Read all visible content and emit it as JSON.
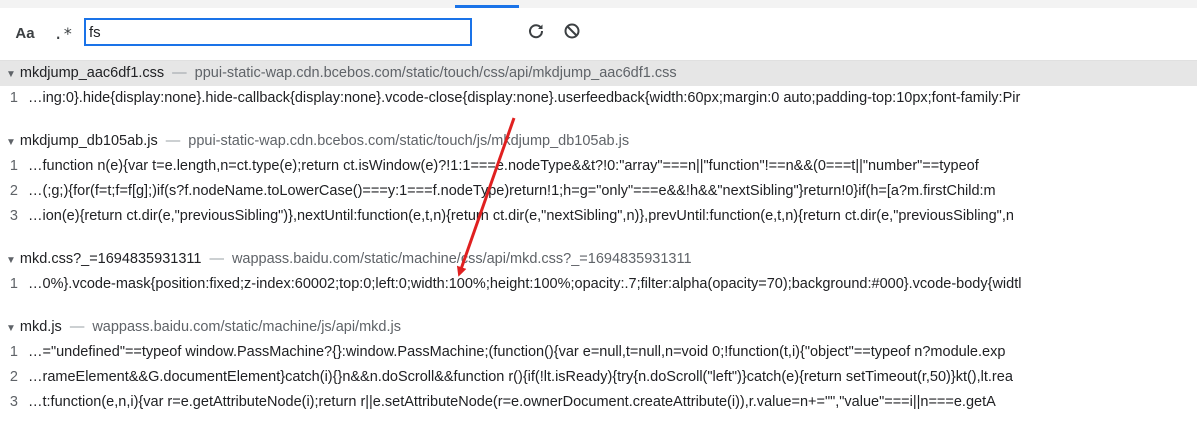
{
  "search": {
    "case_label": "Aa",
    "regex_label": ".*",
    "query": "fs"
  },
  "icons": {
    "refresh": "refresh-icon",
    "clear": "clear-icon",
    "expand": "triangle-down-icon"
  },
  "colors": {
    "accent": "#1a73e8",
    "selected_row": "#e6e6e6",
    "annotation_arrow": "#e02020"
  },
  "files": [
    {
      "name": "mkdjump_aac6df1.css",
      "separator": "—",
      "url": "ppui-static-wap.cdn.bcebos.com/static/touch/css/api/mkdjump_aac6df1.css",
      "lines": [
        {
          "num": "1",
          "text": "…ing:0}.hide{display:none}.hide-callback{display:none}.vcode-close{display:none}.userfeedback{width:60px;margin:0 auto;padding-top:10px;font-family:Pir"
        }
      ]
    },
    {
      "name": "mkdjump_db105ab.js",
      "separator": "—",
      "url": "ppui-static-wap.cdn.bcebos.com/static/touch/js/mkdjump_db105ab.js",
      "lines": [
        {
          "num": "1",
          "text": "…function n(e){var t=e.length,n=ct.type(e);return ct.isWindow(e)?!1:1===e.nodeType&&t?!0:\"array\"===n||\"function\"!==n&&(0===t||\"number\"==typeof"
        },
        {
          "num": "2",
          "text": "…(;g;){for(f=t;f=f[g];)if(s?f.nodeName.toLowerCase()===y:1===f.nodeType)return!1;h=g=\"only\"===e&&!h&&\"nextSibling\"}return!0}if(h=[a?m.firstChild:m"
        },
        {
          "num": "3",
          "text": "…ion(e){return ct.dir(e,\"previousSibling\")},nextUntil:function(e,t,n){return ct.dir(e,\"nextSibling\",n)},prevUntil:function(e,t,n){return ct.dir(e,\"previousSibling\",n"
        }
      ]
    },
    {
      "name": "mkd.css?_=1694835931311",
      "separator": "—",
      "url": "wappass.baidu.com/static/machine/css/api/mkd.css?_=1694835931311",
      "lines": [
        {
          "num": "1",
          "text": "…0%}.vcode-mask{position:fixed;z-index:60002;top:0;left:0;width:100%;height:100%;opacity:.7;filter:alpha(opacity=70);background:#000}.vcode-body{widtl"
        }
      ]
    },
    {
      "name": "mkd.js",
      "separator": "—",
      "url": "wappass.baidu.com/static/machine/js/api/mkd.js",
      "lines": [
        {
          "num": "1",
          "text": "…=\"undefined\"==typeof window.PassMachine?{}:window.PassMachine;(function(){var e=null,t=null,n=void 0;!function(t,i){\"object\"==typeof n?module.exp"
        },
        {
          "num": "2",
          "text": "…rameElement&&G.documentElement}catch(i){}n&&n.doScroll&&function r(){if(!lt.isReady){try{n.doScroll(\"left\")}catch(e){return setTimeout(r,50)}kt(),lt.rea"
        },
        {
          "num": "3",
          "text": "…t:function(e,n,i){var r=e.getAttributeNode(i);return r||e.setAttributeNode(r=e.ownerDocument.createAttribute(i)),r.value=n+=\"\",\"value\"===i||n===e.getA"
        }
      ]
    }
  ]
}
